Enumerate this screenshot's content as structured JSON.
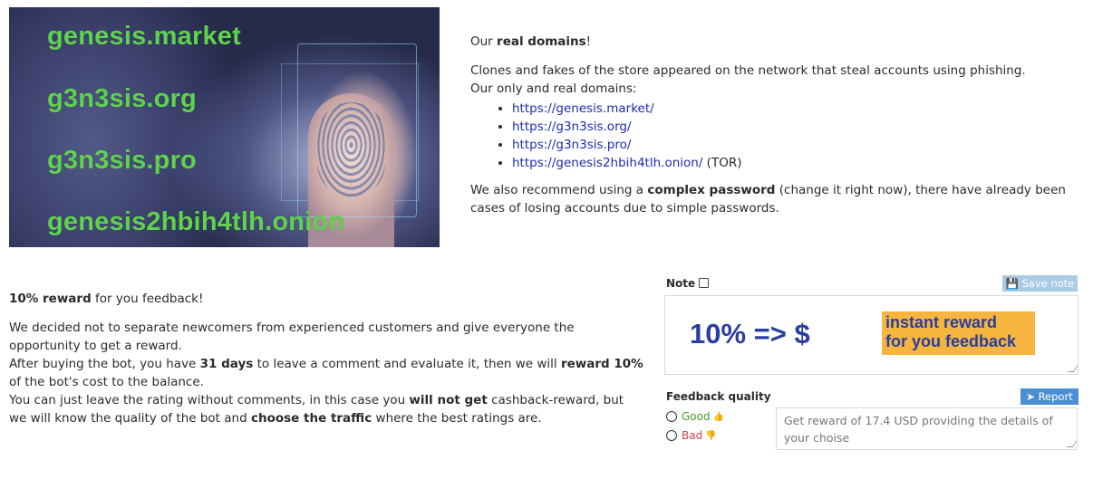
{
  "hero": {
    "domains": [
      "genesis.market",
      "g3n3sis.org",
      "g3n3sis.pro",
      "genesis2hbih4tlh.onion"
    ]
  },
  "domains_info": {
    "heading_prefix": "Our ",
    "heading_bold": "real domains",
    "heading_suffix": "!",
    "intro_line1": "Clones and fakes of the store appeared on the network that steal accounts using phishing.",
    "intro_line2": "Our only and real domains:",
    "links": [
      {
        "url": "https://genesis.market/",
        "suffix": ""
      },
      {
        "url": "https://g3n3sis.org/",
        "suffix": ""
      },
      {
        "url": "https://g3n3sis.pro/",
        "suffix": ""
      },
      {
        "url": "https://genesis2hbih4tlh.onion/",
        "suffix": " (TOR)"
      }
    ],
    "password_prefix": "We also recommend using a ",
    "password_bold": "complex password",
    "password_suffix": " (change it right now), there have already been cases of losing accounts due to simple passwords."
  },
  "reward": {
    "title_bold": "10% reward",
    "title_rest": " for you feedback!",
    "p1": "We decided not to separate newcomers from experienced customers and give everyone the opportunity to get a reward.",
    "p2a": "After buying the bot, you have ",
    "p2b": "31 days",
    "p2c": " to leave a comment and evaluate it, then we will ",
    "p2d": "reward 10%",
    "p2e": " of the bot's cost to the balance.",
    "p3a": "You can just leave the rating without comments, in this case you ",
    "p3b": "will not get",
    "p3c": " cashback-reward, but we will know the quality of the bot and ",
    "p3d": "choose the traffic",
    "p3e": " where the best ratings are."
  },
  "note": {
    "label": "Note",
    "save_label": "Save note",
    "big_text": "10% => $",
    "promo_line1": "instant reward",
    "promo_line2": "for you feedback"
  },
  "feedback": {
    "label": "Feedback quality",
    "report_label": "Report",
    "good_label": "Good",
    "bad_label": "Bad",
    "placeholder": "Get reward of 17.4 USD providing the details of your choise"
  }
}
